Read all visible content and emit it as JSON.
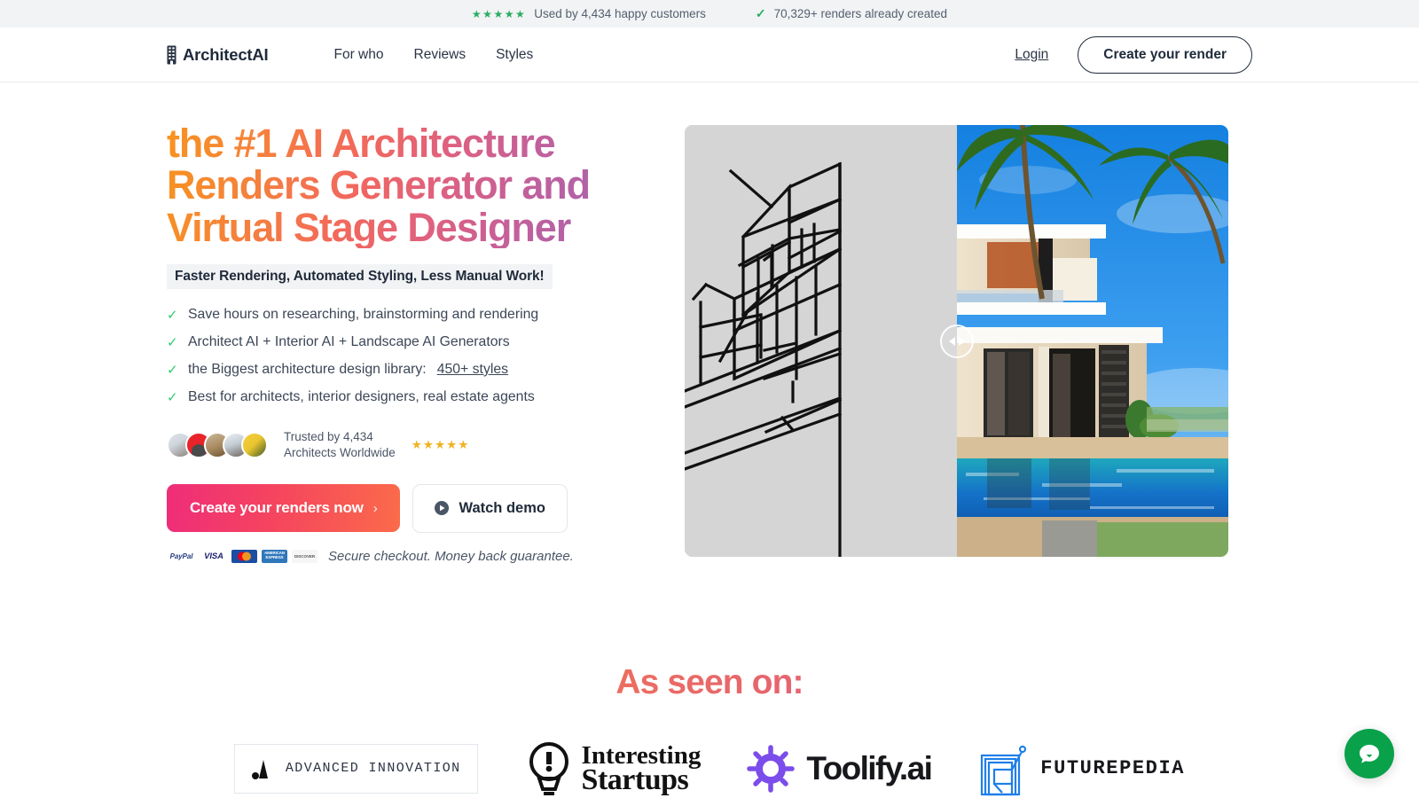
{
  "announcement": {
    "stars": "★★★★★",
    "customers_text": "Used by 4,434 happy customers",
    "check_glyph": "✓",
    "renders_text": "70,329+ renders already created"
  },
  "header": {
    "brand": "ArchitectAI",
    "brand_icon": "building-icon",
    "nav": [
      {
        "label": "For who"
      },
      {
        "label": "Reviews"
      },
      {
        "label": "Styles"
      }
    ],
    "login_label": "Login",
    "cta_label": "Create your render"
  },
  "hero": {
    "headline": "the #1 AI Architecture Renders Generator and Virtual Stage Designer",
    "subbadge": "Faster Rendering, Automated Styling, Less Manual Work!",
    "features": [
      {
        "tick": "✓",
        "text": "Save hours on researching, brainstorming and rendering"
      },
      {
        "tick": "✓",
        "text": "Architect AI + Interior AI + Landscape AI Generators"
      },
      {
        "tick": "✓",
        "text": "the Biggest architecture design library:",
        "link": "450+ styles"
      },
      {
        "tick": "✓",
        "text": "Best for architects, interior designers, real estate agents"
      }
    ],
    "trust": {
      "line1": "Trusted by 4,434",
      "line2": "Architects Worldwide",
      "stars": "★★★★★",
      "avatar_count": 5
    },
    "cta_primary": "Create your renders now",
    "cta_primary_chevron": "›",
    "cta_demo": "Watch demo",
    "payments": [
      "PayPal",
      "VISA",
      "Mastercard",
      "AMERICAN EXPRESS",
      "DISCOVER"
    ],
    "secure_text": "Secure checkout. Money back guarantee.",
    "slider": {
      "before_label": "line-sketch-render",
      "after_label": "photorealistic-villa-render",
      "position_percent": 50
    }
  },
  "as_seen_on": {
    "title": "As seen on:",
    "logos": [
      {
        "name": "Advanced Innovation",
        "text": "ADVANCED INNOVATION"
      },
      {
        "name": "Interesting Startups",
        "line1": "Interesting",
        "line2": "Startups"
      },
      {
        "name": "Toolify.ai",
        "text": "Toolify.ai"
      },
      {
        "name": "Futurepedia",
        "text": "FUTUREPEDIA"
      }
    ]
  },
  "chat": {
    "label": "chat-widget"
  },
  "colors": {
    "gradient_start": "#f7941e",
    "gradient_mid": "#e6656f",
    "gradient_end": "#a763ae",
    "cta_pink": "#ef2d79",
    "cta_orange": "#fb6b4a",
    "green": "#27ae60",
    "gold": "#f0b323",
    "chat_green": "#0aa14b",
    "ink": "#1f2a3a"
  }
}
